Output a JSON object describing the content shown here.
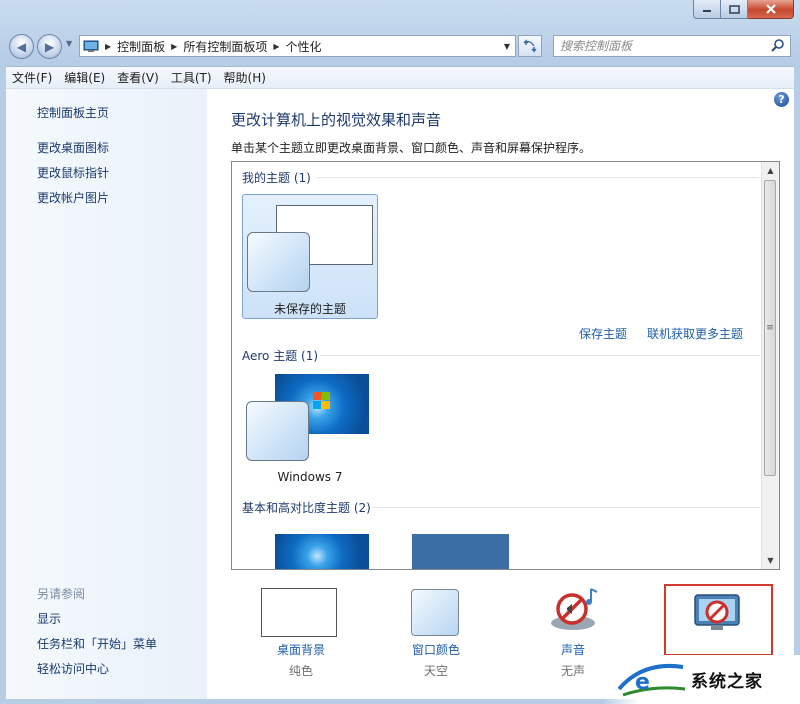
{
  "window": {
    "caption_buttons": [
      "minimize-icon",
      "maximize-icon",
      "close-icon"
    ]
  },
  "address": {
    "crumbs": [
      "控制面板",
      "所有控制面板项",
      "个性化"
    ],
    "search_placeholder": "搜索控制面板"
  },
  "menu": {
    "items": [
      "文件(F)",
      "编辑(E)",
      "查看(V)",
      "工具(T)",
      "帮助(H)"
    ]
  },
  "sidebar": {
    "home": "控制面板主页",
    "links": [
      "更改桌面图标",
      "更改鼠标指针",
      "更改帐户图片"
    ],
    "see_also_heading": "另请参阅",
    "see_also": [
      "显示",
      "任务栏和「开始」菜单",
      "轻松访问中心"
    ]
  },
  "main": {
    "title": "更改计算机上的视觉效果和声音",
    "description": "单击某个主题立即更改桌面背景、窗口颜色、声音和屏幕保护程序。",
    "groups": {
      "my_themes": "我的主题 (1)",
      "aero_themes": "Aero 主题 (1)",
      "basic_themes": "基本和高对比度主题 (2)"
    },
    "unsaved_theme": "未保存的主题",
    "save_theme": "保存主题",
    "get_more_themes": "联机获取更多主题",
    "windows7_theme": "Windows 7"
  },
  "bottom": {
    "desktop_background": {
      "label": "桌面背景",
      "value": "纯色"
    },
    "window_color": {
      "label": "窗口颜色",
      "value": "天空"
    },
    "sounds": {
      "label": "声音",
      "value": "无声"
    }
  },
  "watermark": {
    "text": "系统之家"
  },
  "colors": {
    "link": "#1f5ea8",
    "title": "#1e3a6e",
    "highlight_box": "#d03a2e"
  }
}
